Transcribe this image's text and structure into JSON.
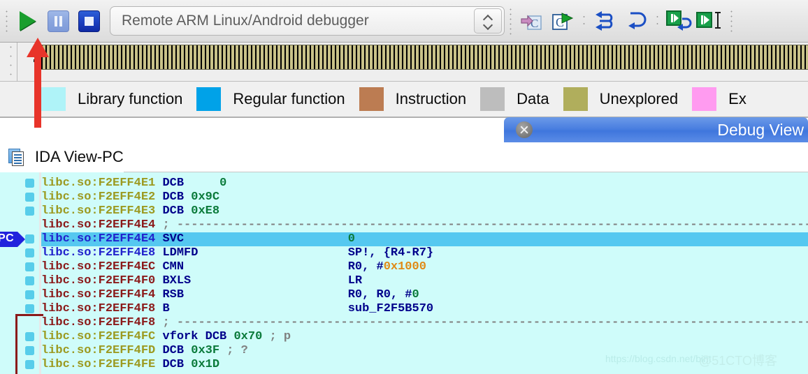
{
  "toolbar": {
    "play_label": "Run",
    "pause_label": "Pause",
    "stop_label": "Terminate process",
    "debugger_select": "Remote ARM Linux/Android debugger",
    "icons": [
      {
        "name": "step-into-icon",
        "label": "Step into"
      },
      {
        "name": "run-to-cursor-icon",
        "label": "Run to cursor"
      },
      {
        "name": "step-over-icon",
        "label": "Step over"
      },
      {
        "name": "step-out-icon",
        "label": "Step out"
      },
      {
        "name": "run-until-return-icon",
        "label": "Run until return"
      },
      {
        "name": "step-instruction-icon",
        "label": "Step one instruction"
      }
    ]
  },
  "navband": {
    "label": "navigation-band",
    "color": "#c9c289"
  },
  "legend": {
    "items": [
      {
        "label": "Library function",
        "color": "#aff3f8"
      },
      {
        "label": "Regular function",
        "color": "#00a2e8"
      },
      {
        "label": "Instruction",
        "color": "#bc7c52"
      },
      {
        "label": "Data",
        "color": "#bdbdbd"
      },
      {
        "label": "Unexplored",
        "color": "#b0ae5c"
      },
      {
        "label": "Ex",
        "color": "#ff9bf0"
      }
    ]
  },
  "debug_view": {
    "title": "Debug View",
    "close_label": "Close"
  },
  "tab": {
    "label": "IDA View-PC",
    "icon": "document-icon"
  },
  "disassembly": {
    "pc_marker": "PC",
    "lines": [
      {
        "addr": "libc.so:F2EFF4E1",
        "addr_color": "olive",
        "mnem": "DCB",
        "operand": "0",
        "operand_color": "green",
        "comment": "",
        "highlight": false,
        "name": ""
      },
      {
        "addr": "libc.so:F2EFF4E2",
        "addr_color": "olive",
        "mnem": "DCB",
        "operand": "0x9C",
        "operand_color": "green",
        "comment": "",
        "highlight": false,
        "name": ""
      },
      {
        "addr": "libc.so:F2EFF4E3",
        "addr_color": "olive",
        "mnem": "DCB",
        "operand": "0xE8",
        "operand_color": "green",
        "comment": "",
        "highlight": false,
        "name": ""
      },
      {
        "addr": "libc.so:F2EFF4E4",
        "addr_color": "red",
        "mnem": "",
        "operand": "",
        "operand_color": "",
        "comment": "separator",
        "highlight": false,
        "name": ""
      },
      {
        "addr": "libc.so:F2EFF4E4",
        "addr_color": "blue",
        "mnem": "SVC",
        "operand": "0",
        "operand_color": "green",
        "comment": "",
        "highlight": true,
        "name": ""
      },
      {
        "addr": "libc.so:F2EFF4E8",
        "addr_color": "blue",
        "mnem": "LDMFD",
        "operand": "SP!, {R4-R7}",
        "operand_color": "dark",
        "comment": "",
        "highlight": false,
        "name": ""
      },
      {
        "addr": "libc.so:F2EFF4EC",
        "addr_color": "red",
        "mnem": "CMN",
        "operand": "R0, #0x1000",
        "operand_color": "mixed",
        "comment": "",
        "highlight": false,
        "name": ""
      },
      {
        "addr": "libc.so:F2EFF4F0",
        "addr_color": "red",
        "mnem": "BXLS",
        "operand": "LR",
        "operand_color": "dark",
        "comment": "",
        "highlight": false,
        "name": ""
      },
      {
        "addr": "libc.so:F2EFF4F4",
        "addr_color": "red",
        "mnem": "RSB",
        "operand": "R0, R0, #0",
        "operand_color": "mixed2",
        "comment": "",
        "highlight": false,
        "name": ""
      },
      {
        "addr": "libc.so:F2EFF4F8",
        "addr_color": "red",
        "mnem": "B",
        "operand": "sub_F2F5B570",
        "operand_color": "dark",
        "comment": "",
        "highlight": false,
        "name": ""
      },
      {
        "addr": "libc.so:F2EFF4F8",
        "addr_color": "red",
        "mnem": "",
        "operand": "",
        "operand_color": "",
        "comment": "separator",
        "highlight": false,
        "name": ""
      },
      {
        "addr": "libc.so:F2EFF4FC",
        "addr_color": "olive",
        "mnem": "DCB",
        "operand": "0x70",
        "operand_color": "green",
        "comment": "; p",
        "highlight": false,
        "name": "vfork"
      },
      {
        "addr": "libc.so:F2EFF4FD",
        "addr_color": "olive",
        "mnem": "DCB",
        "operand": "0x3F",
        "operand_color": "green",
        "comment": "; ?",
        "highlight": false,
        "name": ""
      },
      {
        "addr": "libc.so:F2EFF4FE",
        "addr_color": "olive",
        "mnem": "DCB",
        "operand": "0x1D",
        "operand_color": "green",
        "comment": "",
        "highlight": false,
        "name": ""
      }
    ]
  },
  "annotation": {
    "arrow_color": "#e8342a",
    "arrow_label": "points-to-run-button"
  },
  "watermark": {
    "url": "https://blog.csdn.net/bint",
    "site": "@51CTO博客"
  }
}
